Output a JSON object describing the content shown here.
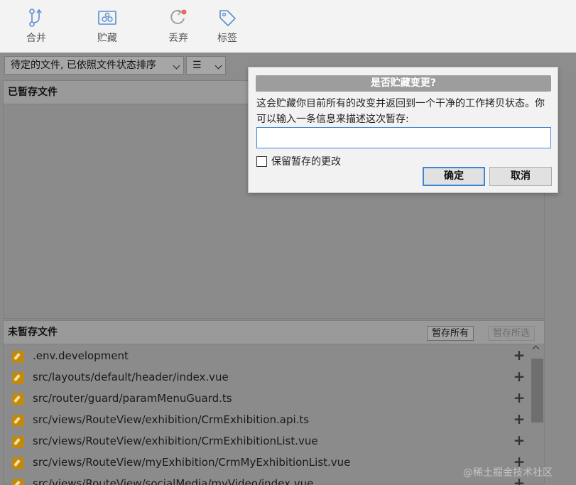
{
  "toolbar": {
    "merge": {
      "label": "合并",
      "icon": "merge-icon"
    },
    "stash": {
      "label": "贮藏",
      "icon": "stash-icon"
    },
    "discard": {
      "label": "丢弃",
      "icon": "discard-icon"
    },
    "tag": {
      "label": "标签",
      "icon": "tag-icon"
    }
  },
  "filter": {
    "sort_select": "待定的文件, 已依照文件状态排序",
    "view_select": "☰"
  },
  "staged": {
    "title": "已暂存文件"
  },
  "unstaged": {
    "title": "未暂存文件",
    "stage_all": "暂存所有",
    "stage_selected": "暂存所选",
    "files": [
      {
        "name": ".env.development"
      },
      {
        "name": "src/layouts/default/header/index.vue"
      },
      {
        "name": "src/router/guard/paramMenuGuard.ts"
      },
      {
        "name": "src/views/RouteView/exhibition/CrmExhibition.api.ts"
      },
      {
        "name": "src/views/RouteView/exhibition/CrmExhibitionList.vue"
      },
      {
        "name": "src/views/RouteView/myExhibition/CrmMyExhibitionList.vue"
      },
      {
        "name": "src/views/RouteView/socialMedia/myVideo/index.vue"
      }
    ]
  },
  "dialog": {
    "title": "是否贮藏变更?",
    "message": "这会贮藏你目前所有的改变并返回到一个干净的工作拷贝状态。你可以输入一条信息来描述这次暂存:",
    "input_value": "",
    "keep_staged_label": "保留暂存的更改",
    "keep_staged_checked": false,
    "ok_label": "确定",
    "cancel_label": "取消"
  },
  "watermark": "@稀土掘金技术社区",
  "colors": {
    "accent": "#3c84d6",
    "file_modified": "#c08a12",
    "discard_dot": "#e86a5f"
  }
}
